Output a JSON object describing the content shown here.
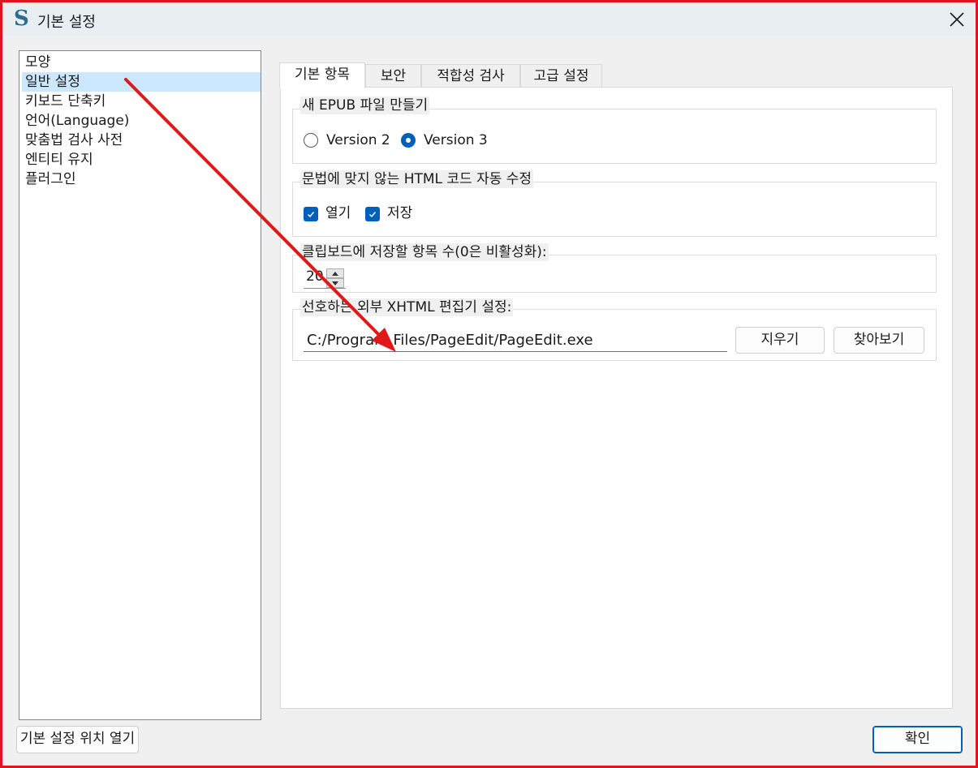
{
  "window": {
    "title": "기본 설정",
    "logo_glyph": "S",
    "border_color": "#e0141e"
  },
  "sidebar": {
    "items": [
      {
        "label": "모양"
      },
      {
        "label": "일반 설정",
        "selected": true
      },
      {
        "label": "키보드 단축키"
      },
      {
        "label": "언어(Language)"
      },
      {
        "label": "맞춤법 검사 사전"
      },
      {
        "label": "엔티티 유지"
      },
      {
        "label": "플러그인"
      }
    ]
  },
  "tabs": [
    {
      "label": "기본 항목",
      "active": true
    },
    {
      "label": "보안"
    },
    {
      "label": "적합성 검사"
    },
    {
      "label": "고급 설정"
    }
  ],
  "groups": {
    "epub": {
      "legend": "새 EPUB 파일 만들기",
      "option_v2": "Version 2",
      "option_v3": "Version 3",
      "selected": "Version 3"
    },
    "fix_html": {
      "legend": "문법에 맞지 않는 HTML 코드 자동 수정",
      "open_label": "열기",
      "save_label": "저장",
      "open_checked": true,
      "save_checked": true
    },
    "clipboard": {
      "legend": "클립보드에 저장할 항목 수(0은 비활성화):",
      "value": "20"
    },
    "xhtml_editor": {
      "legend": "선호하는 외부 XHTML 편집기 설정:",
      "path": "C:/Program Files/PageEdit/PageEdit.exe",
      "clear_label": "지우기",
      "browse_label": "찾아보기"
    }
  },
  "footer": {
    "open_location_label": "기본 설정 위치 열기",
    "ok_label": "확인"
  },
  "icons": {
    "close": "close-icon",
    "app_logo": "sigil-logo-icon",
    "checkmark": "checkmark-icon"
  },
  "annotation": {
    "arrow_color": "#e01818"
  },
  "colors": {
    "accent": "#005fb8",
    "selection": "#cce8ff"
  }
}
